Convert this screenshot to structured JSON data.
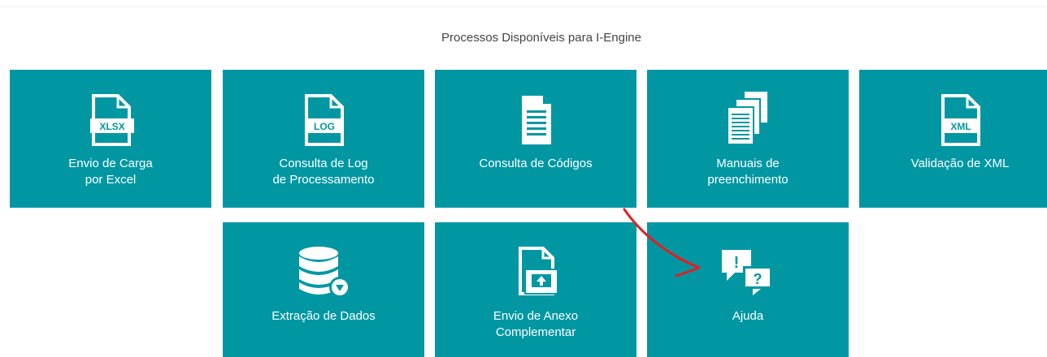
{
  "page": {
    "title": "Processos Disponíveis para I-Engine"
  },
  "colors": {
    "tile_background": "#0097a3",
    "tile_text": "#ffffff",
    "annotation_arrow": "#e02020"
  },
  "tiles": [
    {
      "label": "Envio de Carga\npor Excel",
      "icon": "xlsx-file-icon",
      "badge": "XLSX"
    },
    {
      "label": "Consulta de Log\nde Processamento",
      "icon": "log-file-icon",
      "badge": "LOG"
    },
    {
      "label": "Consulta de Códigos",
      "icon": "document-lines-icon"
    },
    {
      "label": "Manuais de\npreenchimento",
      "icon": "stacked-documents-icon"
    },
    {
      "label": "Validação de XML",
      "icon": "xml-file-icon",
      "badge": "XML"
    },
    {
      "label": "Extração de Dados",
      "icon": "database-download-icon"
    },
    {
      "label": "Envio de Anexo\nComplementar",
      "icon": "upload-attachment-icon"
    },
    {
      "label": "Ajuda",
      "icon": "help-chat-bubbles-icon",
      "bubble_marks": [
        "!",
        "?"
      ]
    }
  ]
}
